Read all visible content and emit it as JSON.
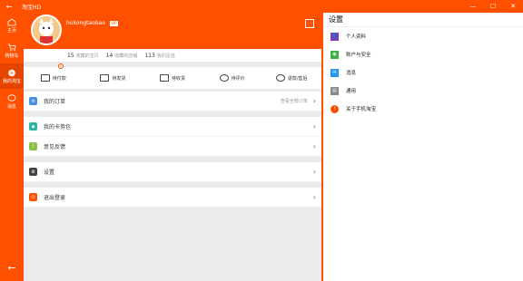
{
  "titlebar": {
    "title": "淘宝HD",
    "back": "←",
    "minimize": "—",
    "maximize": "☐",
    "close": "✕"
  },
  "nav": {
    "items": [
      {
        "label": "主页"
      },
      {
        "label": "购物车"
      },
      {
        "label": "我的淘宝"
      },
      {
        "label": "消息"
      }
    ],
    "back": "←"
  },
  "profile": {
    "username": "hukongtaobao",
    "vip": "VIP",
    "stats": [
      {
        "num": "15",
        "label": "收藏的宝贝"
      },
      {
        "num": "14",
        "label": "收藏的店铺"
      },
      {
        "num": "113",
        "label": "我的足迹"
      }
    ]
  },
  "orders": [
    {
      "label": "待付款",
      "badge": "1"
    },
    {
      "label": "待发货"
    },
    {
      "label": "待收货"
    },
    {
      "label": "待评价"
    },
    {
      "label": "退款/售后"
    }
  ],
  "rows": {
    "my_orders": {
      "label": "我的订单",
      "hint": "查看全部订单"
    },
    "cards": {
      "label": "我的卡劵包"
    },
    "feedback": {
      "label": "意见反馈"
    },
    "settings": {
      "label": "设置"
    },
    "logout": {
      "label": "退出登录"
    }
  },
  "panel": {
    "title": "设置",
    "items": [
      {
        "label": "个人资料",
        "color": "#7b3fb8"
      },
      {
        "label": "账户与安全",
        "color": "#3cb043"
      },
      {
        "label": "消息",
        "color": "#2196f3"
      },
      {
        "label": "通用",
        "color": "#888888"
      },
      {
        "label": "关于手机淘宝",
        "color": "#ff5000"
      }
    ]
  },
  "colors": {
    "accent": "#ff5000"
  },
  "chevron": "›"
}
